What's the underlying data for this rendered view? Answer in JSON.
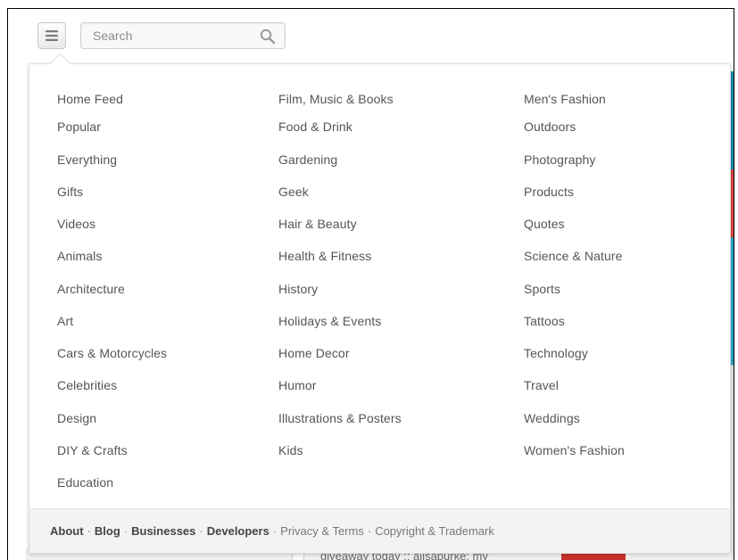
{
  "search": {
    "placeholder": "Search"
  },
  "background": {
    "snippet": "giveaway today :: alisaburke: my"
  },
  "categories": {
    "col1": [
      "Home Feed",
      "Popular",
      "Everything",
      "Gifts",
      "Videos",
      "Animals",
      "Architecture",
      "Art",
      "Cars & Motorcycles",
      "Celebrities",
      "Design",
      "DIY & Crafts",
      "Education"
    ],
    "col2": [
      "Film, Music & Books",
      "Food & Drink",
      "Gardening",
      "Geek",
      "Hair & Beauty",
      "Health & Fitness",
      "History",
      "Holidays & Events",
      "Home Decor",
      "Humor",
      "Illustrations & Posters",
      "Kids"
    ],
    "col3": [
      "Men's Fashion",
      "Outdoors",
      "Photography",
      "Products",
      "Quotes",
      "Science & Nature",
      "Sports",
      "Tattoos",
      "Technology",
      "Travel",
      "Weddings",
      "Women's Fashion"
    ]
  },
  "footer": {
    "about": "About",
    "blog": "Blog",
    "businesses": "Businesses",
    "developers": "Developers",
    "privacy": "Privacy & Terms",
    "copyright": "Copyright & Trademark",
    "separator": "·"
  },
  "icons": {
    "menu": "menu-lines-icon",
    "search": "magnifier-icon"
  },
  "colors": {
    "text": "#555555",
    "footer_bg": "#f3f3f3"
  }
}
